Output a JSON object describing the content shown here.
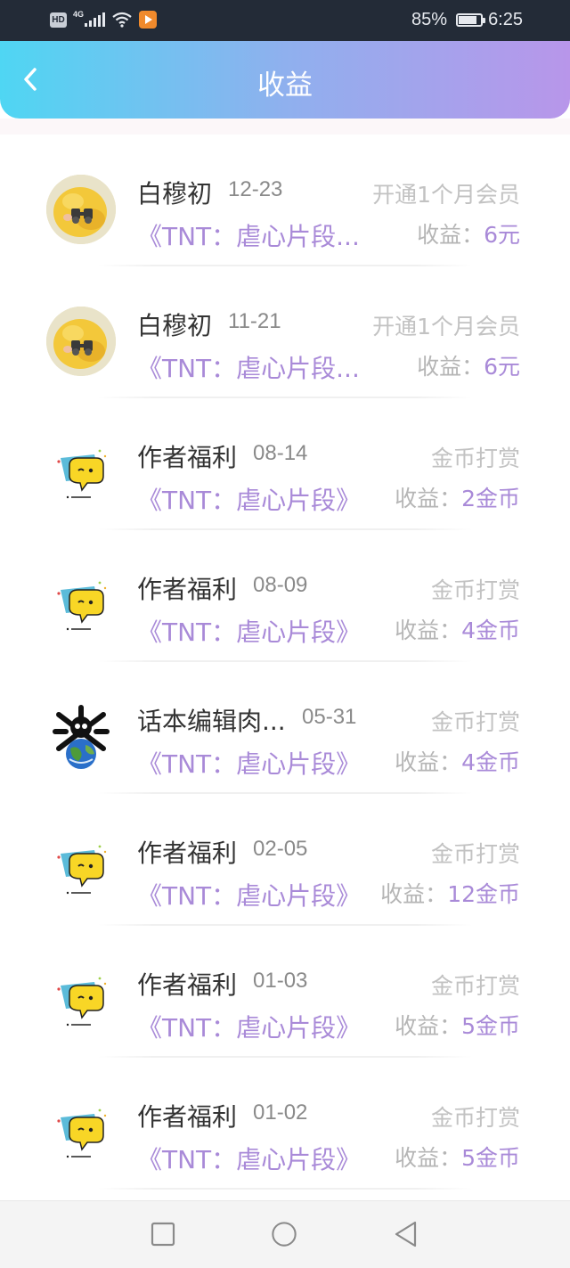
{
  "status_bar": {
    "network_badge": "HD",
    "network_type": "4G",
    "battery_percent": "85%",
    "battery_level": 0.85,
    "time": "6:25",
    "icons": [
      "hd-icon",
      "signal-icon",
      "wifi-icon",
      "video-app-icon",
      "battery-icon"
    ]
  },
  "header": {
    "title": "收益",
    "back_icon": "chevron-left-icon",
    "gradient": [
      "#4fd6f3",
      "#b896ea"
    ]
  },
  "accent_color": "#a98ad8",
  "records": [
    {
      "name": "白穆初",
      "date": "12-23",
      "type": "开通1个月会员",
      "book": "《TNT：虐心片段...",
      "income_label": "收益：",
      "income_value": "6元",
      "avatar": "duck-binoculars-avatar"
    },
    {
      "name": "白穆初",
      "date": "11-21",
      "type": "开通1个月会员",
      "book": "《TNT：虐心片段...",
      "income_label": "收益：",
      "income_value": "6元",
      "avatar": "duck-binoculars-avatar"
    },
    {
      "name": "作者福利",
      "date": "08-14",
      "type": "金币打赏",
      "book": "《TNT：虐心片段》",
      "income_label": "收益：",
      "income_value": "2金币",
      "avatar": "speech-bubble-mascot-avatar"
    },
    {
      "name": "作者福利",
      "date": "08-09",
      "type": "金币打赏",
      "book": "《TNT：虐心片段》",
      "income_label": "收益：",
      "income_value": "4金币",
      "avatar": "speech-bubble-mascot-avatar"
    },
    {
      "name": "话本编辑肉...",
      "date": "05-31",
      "type": "金币打赏",
      "book": "《TNT：虐心片段》",
      "income_label": "收益：",
      "income_value": "4金币",
      "avatar": "earth-skull-avatar"
    },
    {
      "name": "作者福利",
      "date": "02-05",
      "type": "金币打赏",
      "book": "《TNT：虐心片段》",
      "income_label": "收益：",
      "income_value": "12金币",
      "avatar": "speech-bubble-mascot-avatar"
    },
    {
      "name": "作者福利",
      "date": "01-03",
      "type": "金币打赏",
      "book": "《TNT：虐心片段》",
      "income_label": "收益：",
      "income_value": "5金币",
      "avatar": "speech-bubble-mascot-avatar"
    },
    {
      "name": "作者福利",
      "date": "01-02",
      "type": "金币打赏",
      "book": "《TNT：虐心片段》",
      "income_label": "收益：",
      "income_value": "5金币",
      "avatar": "speech-bubble-mascot-avatar"
    }
  ],
  "nav_bar": {
    "buttons": [
      "recent-apps-icon",
      "home-icon",
      "back-triangle-icon"
    ]
  }
}
